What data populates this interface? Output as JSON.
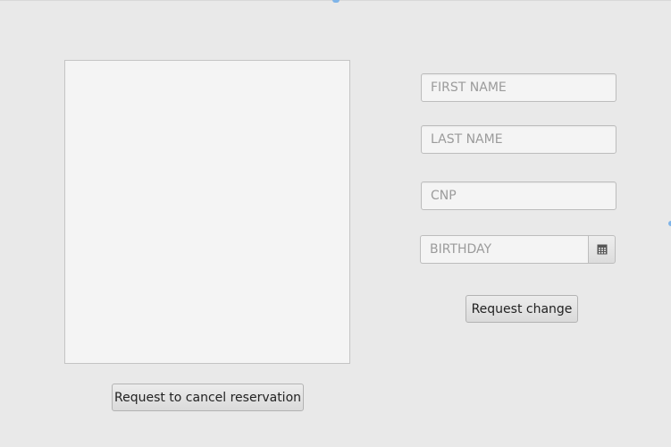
{
  "form": {
    "first_name": {
      "placeholder": "FIRST NAME",
      "value": ""
    },
    "last_name": {
      "placeholder": "LAST NAME",
      "value": ""
    },
    "cnp": {
      "placeholder": "CNP",
      "value": ""
    },
    "birthday": {
      "placeholder": "BIRTHDAY",
      "value": "",
      "icon": "calendar-icon"
    }
  },
  "actions": {
    "request_change_label": "Request change",
    "cancel_reservation_label": "Request to cancel reservation"
  },
  "reservations_list": {
    "items": []
  },
  "colors": {
    "background": "#e9e9e9",
    "field_background": "#f4f4f4",
    "border": "#bdbdbd",
    "focus_accent": "#7fb4e8"
  }
}
